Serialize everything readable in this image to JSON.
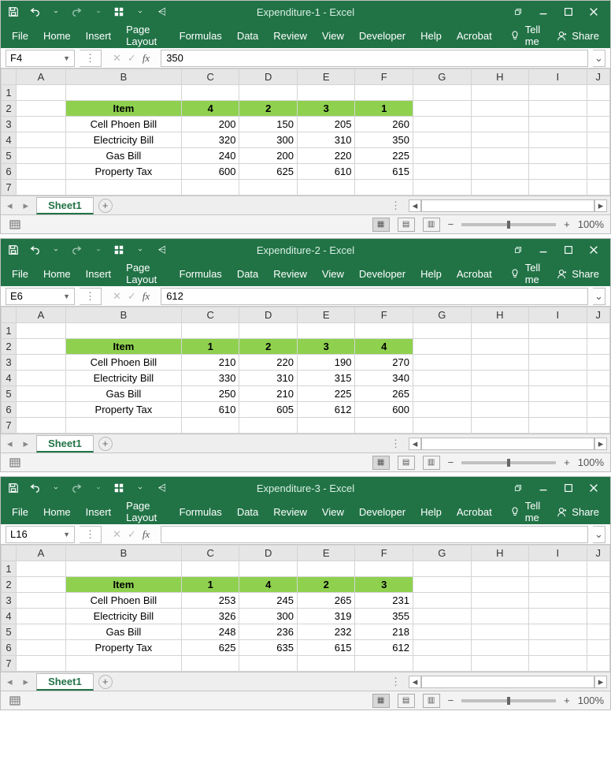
{
  "menu": {
    "file": "File",
    "home": "Home",
    "insert": "Insert",
    "pagelayout": "Page Layout",
    "formulas": "Formulas",
    "data": "Data",
    "review": "Review",
    "view": "View",
    "developer": "Developer",
    "help": "Help",
    "acrobat": "Acrobat",
    "tellme": "Tell me",
    "share": "Share"
  },
  "sheet_tab": "Sheet1",
  "zoom": "100%",
  "qat": {
    "undo": "↶",
    "redo": "↷"
  },
  "col_labels": [
    "A",
    "B",
    "C",
    "D",
    "E",
    "F",
    "G",
    "H",
    "I",
    "J"
  ],
  "row_labels": [
    "1",
    "2",
    "3",
    "4",
    "5",
    "6",
    "7"
  ],
  "windows": [
    {
      "title": "Expenditure-1  -  Excel",
      "namebox": "F4",
      "formula": "350",
      "header": {
        "item": "Item",
        "c": "4",
        "d": "2",
        "e": "3",
        "f": "1"
      },
      "rows": [
        {
          "b": "Cell Phoen Bill",
          "c": "200",
          "d": "150",
          "e": "205",
          "f": "260"
        },
        {
          "b": "Electricity Bill",
          "c": "320",
          "d": "300",
          "e": "310",
          "f": "350"
        },
        {
          "b": "Gas Bill",
          "c": "240",
          "d": "200",
          "e": "220",
          "f": "225"
        },
        {
          "b": "Property Tax",
          "c": "600",
          "d": "625",
          "e": "610",
          "f": "615"
        }
      ]
    },
    {
      "title": "Expenditure-2  -  Excel",
      "namebox": "E6",
      "formula": "612",
      "header": {
        "item": "Item",
        "c": "1",
        "d": "2",
        "e": "3",
        "f": "4"
      },
      "rows": [
        {
          "b": "Cell Phoen Bill",
          "c": "210",
          "d": "220",
          "e": "190",
          "f": "270"
        },
        {
          "b": "Electricity Bill",
          "c": "330",
          "d": "310",
          "e": "315",
          "f": "340"
        },
        {
          "b": "Gas Bill",
          "c": "250",
          "d": "210",
          "e": "225",
          "f": "265"
        },
        {
          "b": "Property Tax",
          "c": "610",
          "d": "605",
          "e": "612",
          "f": "600"
        }
      ]
    },
    {
      "title": "Expenditure-3  -  Excel",
      "namebox": "L16",
      "formula": "",
      "header": {
        "item": "Item",
        "c": "1",
        "d": "4",
        "e": "2",
        "f": "3"
      },
      "rows": [
        {
          "b": "Cell Phoen Bill",
          "c": "253",
          "d": "245",
          "e": "265",
          "f": "231"
        },
        {
          "b": "Electricity Bill",
          "c": "326",
          "d": "300",
          "e": "319",
          "f": "355"
        },
        {
          "b": "Gas Bill",
          "c": "248",
          "d": "236",
          "e": "232",
          "f": "218"
        },
        {
          "b": "Property Tax",
          "c": "625",
          "d": "635",
          "e": "615",
          "f": "612"
        }
      ]
    }
  ]
}
